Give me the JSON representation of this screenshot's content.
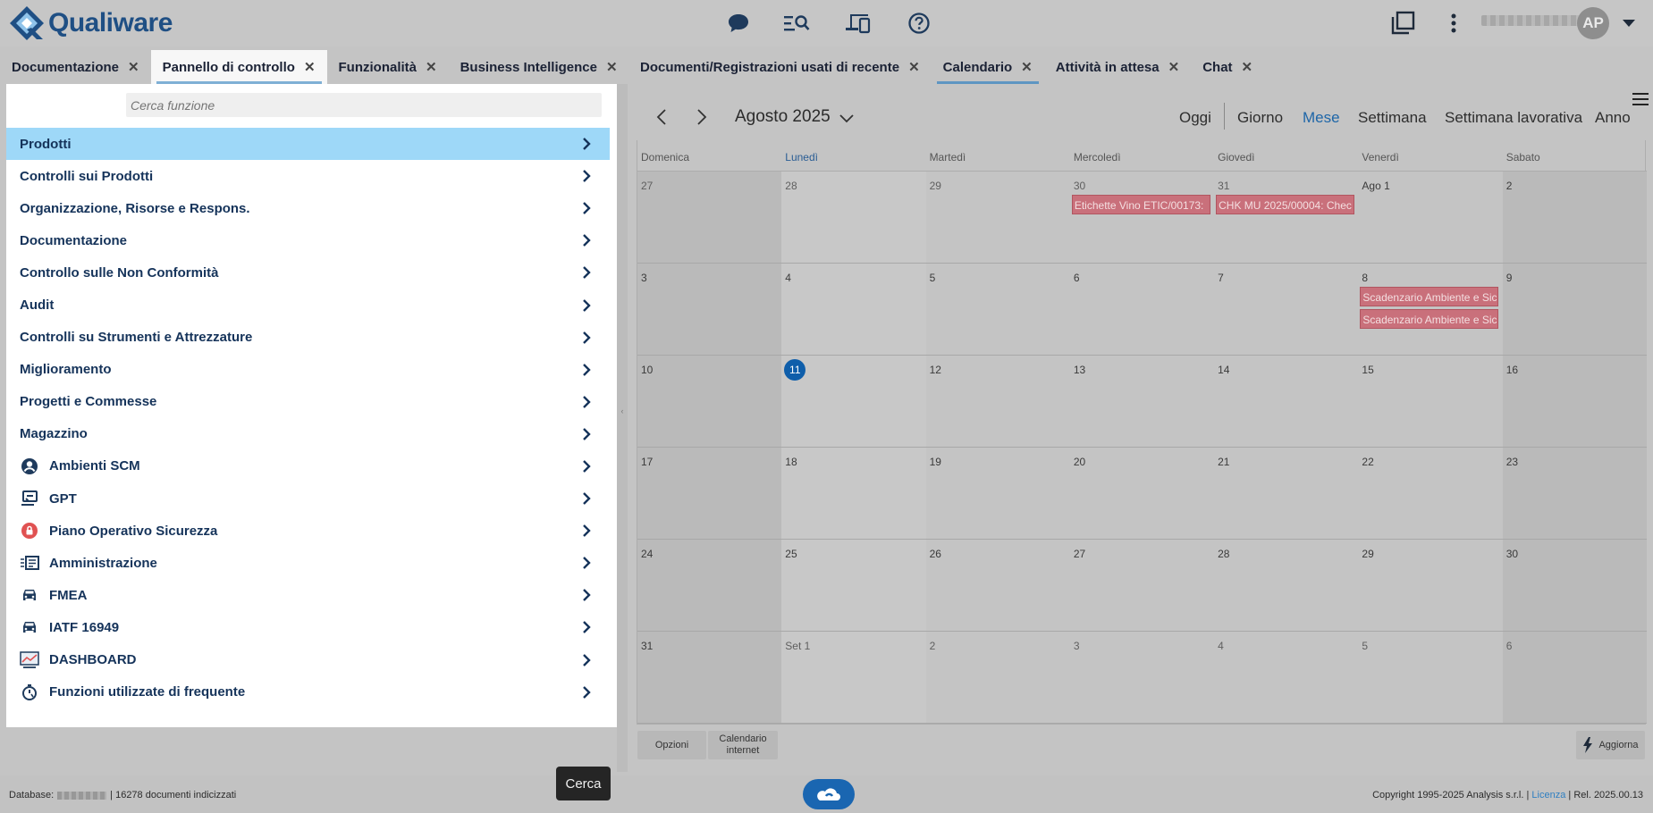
{
  "app": {
    "logo_text": "Qualiware",
    "avatar_initials": "AP",
    "brand_color": "#1f4f84",
    "header_icons": [
      "chat-icon",
      "search-list-icon",
      "devices-icon",
      "help-icon",
      "windows-icon",
      "more-vertical-icon",
      "dropdown-caret-icon"
    ]
  },
  "left_tabs": [
    {
      "label": "Documentazione"
    },
    {
      "label": "Pannello di controllo"
    },
    {
      "label": "Funzionalità"
    },
    {
      "label": "Business Intelligence"
    }
  ],
  "right_tabs": [
    {
      "label": "Documenti/Registrazioni usati di recente"
    },
    {
      "label": "Calendario"
    },
    {
      "label": "Attività in attesa"
    },
    {
      "label": "Chat"
    }
  ],
  "search": {
    "placeholder": "Cerca funzione"
  },
  "menu": [
    {
      "label": "Prodotti",
      "icon": ""
    },
    {
      "label": "Controlli sui Prodotti",
      "icon": ""
    },
    {
      "label": "Organizzazione, Risorse e Respons.",
      "icon": ""
    },
    {
      "label": "Documentazione",
      "icon": ""
    },
    {
      "label": "Controllo sulle Non Conformità",
      "icon": ""
    },
    {
      "label": "Audit",
      "icon": ""
    },
    {
      "label": "Controlli su Strumenti e Attrezzature",
      "icon": ""
    },
    {
      "label": "Miglioramento",
      "icon": ""
    },
    {
      "label": "Progetti e Commesse",
      "icon": ""
    },
    {
      "label": "Magazzino",
      "icon": ""
    },
    {
      "label": "Ambienti SCM",
      "icon": "account-circle-icon"
    },
    {
      "label": "GPT",
      "icon": "gpt-icon"
    },
    {
      "label": "Piano Operativo Sicurezza",
      "icon": "lock-badge-icon"
    },
    {
      "label": "Amministrazione",
      "icon": "admin-list-icon"
    },
    {
      "label": "FMEA",
      "icon": "car-icon"
    },
    {
      "label": "IATF 16949",
      "icon": "car-icon"
    },
    {
      "label": "DASHBOARD",
      "icon": "dashboard-chart-icon"
    },
    {
      "label": "Funzioni utilizzate di frequente",
      "icon": "stopwatch-icon"
    }
  ],
  "calendar": {
    "month_title": "Agosto 2025",
    "views": [
      "Oggi",
      "Giorno",
      "Mese",
      "Settimana",
      "Settimana lavorativa",
      "Anno"
    ],
    "active_view": "Mese",
    "weekdays": [
      "Domenica",
      "Lunedì",
      "Martedì",
      "Mercoledì",
      "Giovedì",
      "Venerdì",
      "Sabato"
    ],
    "today": "11",
    "weeks": [
      [
        "27",
        "28",
        "29",
        "30",
        "31",
        "Ago 1",
        "2"
      ],
      [
        "3",
        "4",
        "5",
        "6",
        "7",
        "8",
        "9"
      ],
      [
        "10",
        "11",
        "12",
        "13",
        "14",
        "15",
        "16"
      ],
      [
        "17",
        "18",
        "19",
        "20",
        "21",
        "22",
        "23"
      ],
      [
        "24",
        "25",
        "26",
        "27",
        "28",
        "29",
        "30"
      ],
      [
        "31",
        "Set 1",
        "2",
        "3",
        "4",
        "5",
        "6"
      ]
    ],
    "events": [
      {
        "week": 0,
        "day": 3,
        "slot": 0,
        "title": "Etichette Vino ETIC/00173:"
      },
      {
        "week": 0,
        "day": 4,
        "slot": 0,
        "title": "CHK MU 2025/00004: Chec"
      },
      {
        "week": 1,
        "day": 5,
        "slot": 0,
        "title": "Scadenzario Ambiente e Sic"
      },
      {
        "week": 1,
        "day": 5,
        "slot": 1,
        "title": "Scadenzario Ambiente e Sic"
      }
    ],
    "event_color": "#c9707b",
    "footer": {
      "options_label": "Opzioni",
      "internet_calendar_label": "Calendario internet",
      "refresh_label": "Aggiorna"
    }
  },
  "status": {
    "database_label": "Database:",
    "indexed_docs": "16278 documenti indicizzati",
    "copyright": "Copyright 1995-2025 Analysis s.r.l. |",
    "license_link": "Licenza",
    "release": "| Rel.  2025.00.13",
    "tooltip": "Cerca"
  }
}
